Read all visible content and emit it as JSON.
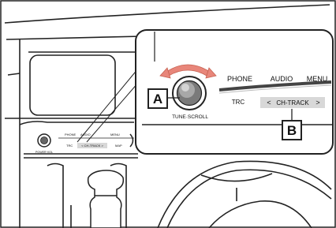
{
  "callouts": {
    "a": "A",
    "b": "B"
  },
  "knob": {
    "label": "TUNE·SCROLL"
  },
  "buttons": {
    "phone": "PHONE",
    "audio": "AUDIO",
    "menu": "MENU",
    "trc": "TRC",
    "ch_track_left": "<",
    "ch_track": "CH-TRACK",
    "ch_track_right": ">"
  },
  "small_panel": {
    "phone": "PHONE",
    "audio": "AUDIO",
    "menu": "MENU",
    "trc": "TRC",
    "ch_track": "< CH-TRACK >",
    "map": "MAP",
    "knob_label": "POWER·VOL"
  },
  "colors": {
    "line": "#222222",
    "arrow": "#e8867a",
    "screen": "#c9c9c9",
    "callout_bg": "#ffffff",
    "button_bar": "#d8d8d8"
  }
}
